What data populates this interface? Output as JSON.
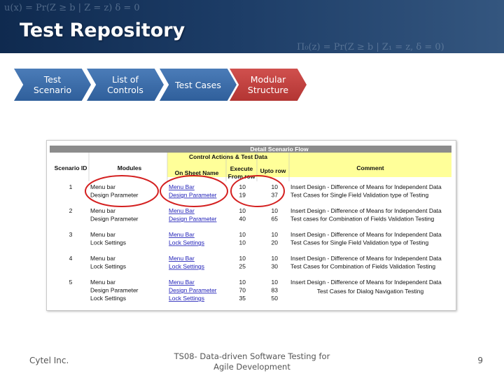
{
  "header": {
    "title": "Test Repository",
    "formula_top": "u(x) = Pr(Z ≥ b | Z = z) δ = 0",
    "formula_bottom": "Π₀(z) = Pr(Z ≥ b | Z₁ = z, δ = 0)"
  },
  "process_steps": [
    {
      "label": "Test Scenario",
      "color": "#3a6ba8"
    },
    {
      "label": "List of Controls",
      "color": "#3a6ba8"
    },
    {
      "label": "Test Cases",
      "color": "#3a6ba8"
    },
    {
      "label": "Modular Structure",
      "color": "#c0403e"
    }
  ],
  "sheet": {
    "banner": "Detail Scenario Flow",
    "group_header": "Control Actions & Test Data",
    "columns": {
      "scenario_id": "Scenario ID",
      "modules": "Modules",
      "sheet_name": "On Sheet Name",
      "execute_from": "Execute From row",
      "upto_row": "Upto row",
      "comment": "Comment"
    },
    "scenarios": [
      {
        "id": "1",
        "rows": [
          {
            "module": "Menu bar",
            "sheet": "Menu Bar",
            "from": "10",
            "to": "10",
            "comment": "Insert Design - Difference of Means for Independent Data"
          },
          {
            "module": "Design Parameter",
            "sheet": "Design Parameter",
            "from": "19",
            "to": "37",
            "comment": "Test Cases for Single Field Validation type of Testing"
          }
        ]
      },
      {
        "id": "2",
        "rows": [
          {
            "module": "Menu bar",
            "sheet": "Menu Bar",
            "from": "10",
            "to": "10",
            "comment": "Insert Design - Difference of Means for Independent Data"
          },
          {
            "module": "Design Parameter",
            "sheet": "Design Parameter",
            "from": "40",
            "to": "65",
            "comment": "Test cases for Combination of Fields Validation Testing"
          }
        ]
      },
      {
        "id": "3",
        "rows": [
          {
            "module": "Menu bar",
            "sheet": "Menu Bar",
            "from": "10",
            "to": "10",
            "comment": "Insert Design - Difference of Means for Independent Data"
          },
          {
            "module": "Lock Settings",
            "sheet": "Lock Settings",
            "from": "10",
            "to": "20",
            "comment": "Test Cases for Single Field Validation type of Testing"
          }
        ]
      },
      {
        "id": "4",
        "rows": [
          {
            "module": "Menu bar",
            "sheet": "Menu Bar",
            "from": "10",
            "to": "10",
            "comment": "Insert Design - Difference of Means for Independent Data"
          },
          {
            "module": "Lock Settings",
            "sheet": "Lock Settings",
            "from": "25",
            "to": "30",
            "comment": "Test Cases for Combination of Fields Validation Testing"
          }
        ]
      },
      {
        "id": "5",
        "rows": [
          {
            "module": "Menu bar",
            "sheet": "Menu Bar",
            "from": "10",
            "to": "10",
            "comment": "Insert Design - Difference of Means for Independent Data"
          },
          {
            "module": "Design Parameter",
            "sheet": "Design Parameter",
            "from": "70",
            "to": "83",
            "comment": ""
          },
          {
            "module": "Lock Settings",
            "sheet": "Lock Settings",
            "from": "35",
            "to": "50",
            "comment": ""
          }
        ],
        "merged_comment": "Test Cases for Dialog Navigation Testing"
      }
    ]
  },
  "footer": {
    "company": "Cytel Inc.",
    "presentation": "TS08- Data-driven Software Testing for Agile Development",
    "page_number": "9"
  },
  "colors": {
    "banner_dark": "#1c3c66",
    "chevron_blue": "#3a6ba8",
    "chevron_red": "#c0403e",
    "sheet_header_gray": "#8c8c8c",
    "sheet_header_yellow": "#ffff99",
    "link_blue": "#1f1fb8",
    "highlight_circle": "#d42020"
  }
}
